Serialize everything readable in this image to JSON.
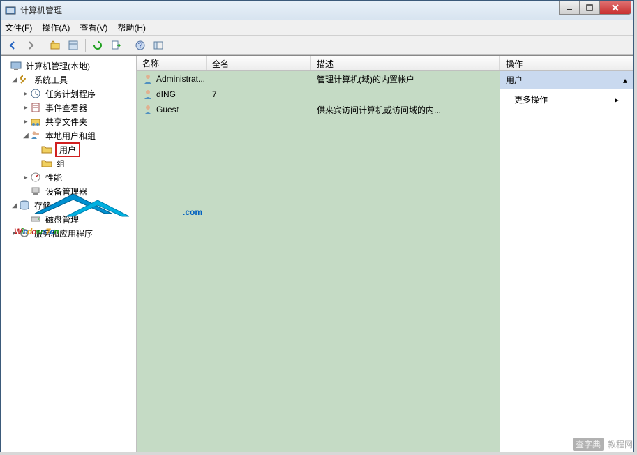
{
  "window": {
    "title": "计算机管理"
  },
  "menu": {
    "file": "文件(F)",
    "action": "操作(A)",
    "view": "查看(V)",
    "help": "帮助(H)"
  },
  "tree": {
    "root": "计算机管理(本地)",
    "system": "系统工具",
    "task": "任务计划程序",
    "event": "事件查看器",
    "share": "共享文件夹",
    "localusers": "本地用户和组",
    "users": "用户",
    "groups": "组",
    "perf": "性能",
    "devmgr": "设备管理器",
    "storage": "存储",
    "diskmgr": "磁盘管理",
    "services": "服务和应用程序"
  },
  "list": {
    "headers": {
      "name": "名称",
      "fullname": "全名",
      "desc": "描述"
    },
    "rows": [
      {
        "name": "Administrat...",
        "fullname": "",
        "desc": "管理计算机(域)的内置帐户"
      },
      {
        "name": "dING",
        "fullname": "7",
        "desc": ""
      },
      {
        "name": "Guest",
        "fullname": "",
        "desc": "供来宾访问计算机或访问域的内..."
      }
    ]
  },
  "actions": {
    "header": "操作",
    "section": "用户",
    "more": "更多操作"
  },
  "watermark": {
    "brand": "Windows7en",
    "suffix": ".com"
  },
  "footer": {
    "site": "查字典",
    "label": "教程网"
  }
}
